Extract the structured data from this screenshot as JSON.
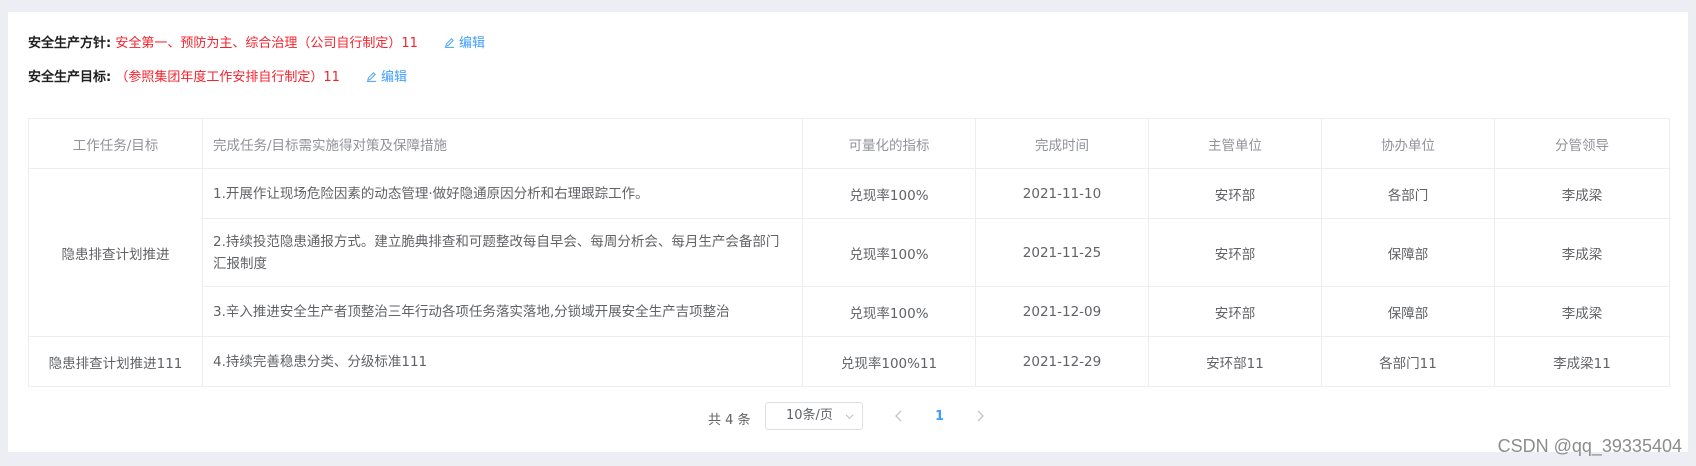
{
  "policy": {
    "label": "安全生产方针:",
    "value": "安全第一、预防为主、综合治理（公司自行制定）11",
    "edit_label": "编辑"
  },
  "goal": {
    "label": "安全生产目标:",
    "value": "（参照集团年度工作安排自行制定）11",
    "edit_label": "编辑"
  },
  "table": {
    "headers": [
      "工作任务/目标",
      "完成任务/目标需实施得对策及保障措施",
      "可量化的指标",
      "完成时间",
      "主管单位",
      "协办单位",
      "分管领导"
    ],
    "groups": [
      {
        "task": "隐患排查计划推进"
      },
      {
        "task": "隐患排查计划推进111"
      }
    ],
    "rows": [
      {
        "measure": "1.开展作让现场危险因素的动态管理·做好隐通原因分析和右理跟踪工作。",
        "indicator": "兑现率100%",
        "date": "2021-11-10",
        "lead_unit": "安环部",
        "assist_unit": "各部门",
        "leader": "李成梁"
      },
      {
        "measure": "2.持续投范隐患通报方式。建立脆典排查和可题整改每自早会、每周分析会、每月生产会备部门汇报制度",
        "indicator": "兑现率100%",
        "date": "2021-11-25",
        "lead_unit": "安环部",
        "assist_unit": "保障部",
        "leader": "李成梁"
      },
      {
        "measure": "3.辛入推进安全生产者顶整治三年行动各项任务落实落地,分锁域开展安全生产吉项整治",
        "indicator": "兑现率100%",
        "date": "2021-12-09",
        "lead_unit": "安环部",
        "assist_unit": "保障部",
        "leader": "李成梁"
      },
      {
        "measure": "4.持续完善稳患分类、分级标准111",
        "indicator": "兑现率100%11",
        "date": "2021-12-29",
        "lead_unit": "安环部11",
        "assist_unit": "各部门11",
        "leader": "李成梁11"
      }
    ]
  },
  "pagination": {
    "total_text": "共 4 条",
    "page_size": "10条/页",
    "current_page": "1"
  },
  "watermark": "CSDN @qq_39335404",
  "colors": {
    "accent": "#409eff",
    "highlight_text": "#f5222d",
    "border": "#ebeef5",
    "page_bg": "#eceef4"
  },
  "icons": [
    "edit-icon",
    "chevron-down-icon",
    "chevron-left-icon",
    "chevron-right-icon"
  ]
}
